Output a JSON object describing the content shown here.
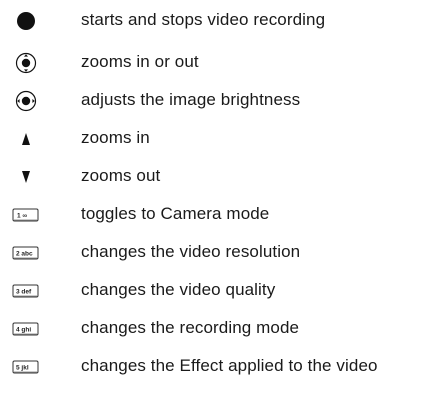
{
  "legend": {
    "items": [
      {
        "icon": "record-button-icon",
        "text": "starts and stops video recording"
      },
      {
        "icon": "navigation-key-updown-icon",
        "text": "zooms in or out"
      },
      {
        "icon": "navigation-key-leftright-icon",
        "text": "adjusts the image brightness"
      },
      {
        "icon": "up-arrow-icon",
        "text": "zooms in"
      },
      {
        "icon": "down-arrow-icon",
        "text": "zooms out"
      },
      {
        "icon": "key-1-icon",
        "key_label": "1 ∞",
        "text": "toggles to Camera mode"
      },
      {
        "icon": "key-2-icon",
        "key_label": "2 abc",
        "text": "changes the video resolution"
      },
      {
        "icon": "key-3-icon",
        "key_label": "3 def",
        "text": "changes the video quality"
      },
      {
        "icon": "key-4-icon",
        "key_label": "4 ghi",
        "text": "changes the recording mode"
      },
      {
        "icon": "key-5-icon",
        "key_label": "5 jkl",
        "text": "changes the Effect applied to the video"
      }
    ]
  }
}
